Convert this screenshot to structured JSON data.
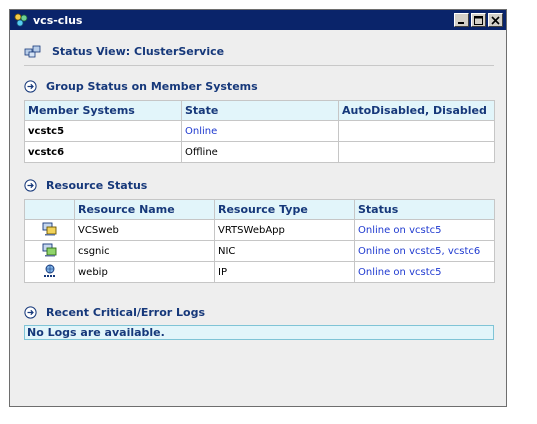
{
  "window": {
    "title": "vcs-clus"
  },
  "status_view": {
    "label": "Status View: ClusterService"
  },
  "group_status": {
    "title": "Group Status on Member Systems",
    "columns": [
      "Member Systems",
      "State",
      "AutoDisabled, Disabled"
    ],
    "rows": [
      {
        "system": "vcstc5",
        "state": "Online",
        "auto_disabled": ""
      },
      {
        "system": "vcstc6",
        "state": "Offline",
        "auto_disabled": ""
      }
    ]
  },
  "resource_status": {
    "title": "Resource Status",
    "columns": [
      "",
      "Resource Name",
      "Resource Type",
      "Status"
    ],
    "rows": [
      {
        "icon": "application-resource-icon",
        "name": "VCSweb",
        "type": "VRTSWebApp",
        "status": "Online on vcstc5"
      },
      {
        "icon": "nic-resource-icon",
        "name": "csgnic",
        "type": "NIC",
        "status": "Online on vcstc5, vcstc6"
      },
      {
        "icon": "ip-resource-icon",
        "name": "webip",
        "type": "IP",
        "status": "Online on vcstc5"
      }
    ]
  },
  "logs": {
    "title": "Recent Critical/Error Logs",
    "message": "No Logs are available."
  },
  "colors": {
    "title_bar": "#0a246a",
    "accent_text": "#16387a",
    "header_bg": "#e2f5fa",
    "link_blue": "#1f3ad0"
  }
}
